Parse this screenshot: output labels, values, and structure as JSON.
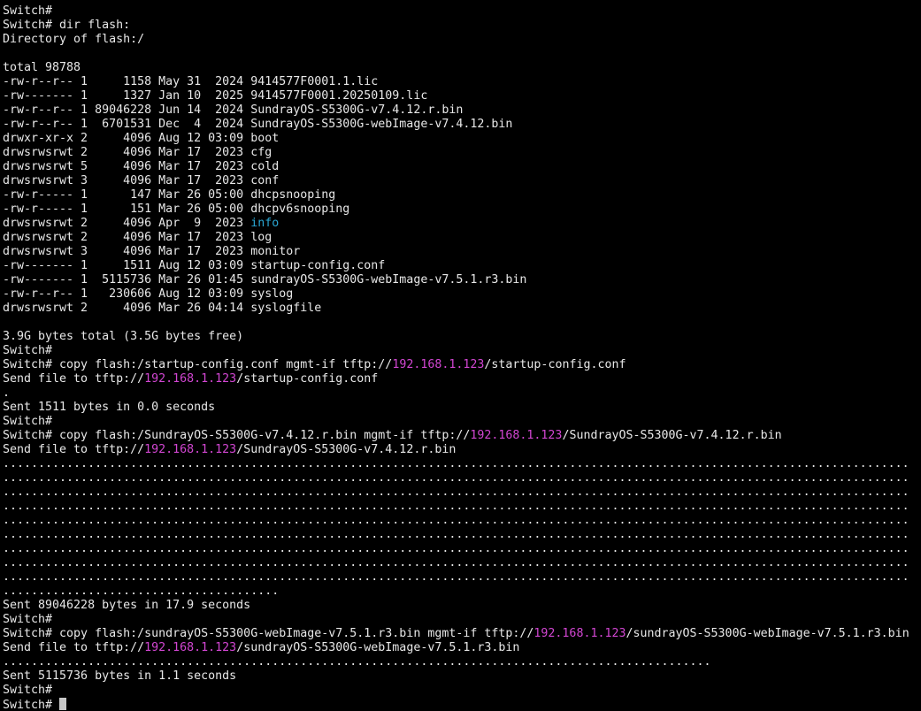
{
  "colors": {
    "background": "#000000",
    "text": "#e8e8e8",
    "ip_address": "#d246d2",
    "directory_info": "#2aa7d4",
    "cursor": "#c8c8c8"
  },
  "terminal": {
    "lines": [
      [
        {
          "t": "Switch#"
        }
      ],
      [
        {
          "t": "Switch#"
        }
      ],
      [
        {
          "t": "Switch# dir flash:"
        }
      ],
      [
        {
          "t": "Directory of flash:/"
        }
      ],
      [
        {
          "t": ""
        }
      ],
      [
        {
          "t": "total 98788"
        }
      ],
      [
        {
          "t": "-rw-r--r-- 1     1158 May 31  2024 9414577F0001.1.lic"
        }
      ],
      [
        {
          "t": "-rw------- 1     1327 Jan 10  2025 9414577F0001.20250109.lic"
        }
      ],
      [
        {
          "t": "-rw-r--r-- 1 89046228 Jun 14  2024 SundrayOS-S5300G-v7.4.12.r.bin"
        }
      ],
      [
        {
          "t": "-rw-r--r-- 1  6701531 Dec  4  2024 SundrayOS-S5300G-webImage-v7.4.12.bin"
        }
      ],
      [
        {
          "t": "drwxr-xr-x 2     4096 Aug 12 03:09 boot"
        }
      ],
      [
        {
          "t": "drwsrwsrwt 2     4096 Mar 17  2023 cfg"
        }
      ],
      [
        {
          "t": "drwsrwsrwt 5     4096 Mar 17  2023 cold"
        }
      ],
      [
        {
          "t": "drwsrwsrwt 3     4096 Mar 17  2023 conf"
        }
      ],
      [
        {
          "t": "-rw-r----- 1      147 Mar 26 05:00 dhcpsnooping"
        }
      ],
      [
        {
          "t": "-rw-r----- 1      151 Mar 26 05:00 dhcpv6snooping"
        }
      ],
      [
        {
          "t": "drwsrwsrwt 2     4096 Apr  9  2023 "
        },
        {
          "t": "info",
          "c": "directory_info"
        }
      ],
      [
        {
          "t": "drwsrwsrwt 2     4096 Mar 17  2023 log"
        }
      ],
      [
        {
          "t": "drwsrwsrwt 3     4096 Mar 17  2023 monitor"
        }
      ],
      [
        {
          "t": "-rw------- 1     1511 Aug 12 03:09 startup-config.conf"
        }
      ],
      [
        {
          "t": "-rw------- 1  5115736 Mar 26 01:45 sundrayOS-S5300G-webImage-v7.5.1.r3.bin"
        }
      ],
      [
        {
          "t": "-rw-r--r-- 1   230606 Aug 12 03:09 syslog"
        }
      ],
      [
        {
          "t": "drwsrwsrwt 2     4096 Mar 26 04:14 syslogfile"
        }
      ],
      [
        {
          "t": ""
        }
      ],
      [
        {
          "t": "3.9G bytes total (3.5G bytes free)"
        }
      ],
      [
        {
          "t": "Switch#"
        }
      ],
      [
        {
          "t": "Switch# copy flash:/startup-config.conf mgmt-if tftp://"
        },
        {
          "t": "192.168.1.123",
          "c": "ip_address"
        },
        {
          "t": "/startup-config.conf"
        }
      ],
      [
        {
          "t": "Send file to tftp://"
        },
        {
          "t": "192.168.1.123",
          "c": "ip_address"
        },
        {
          "t": "/startup-config.conf"
        }
      ],
      [
        {
          "t": "."
        }
      ],
      [
        {
          "t": "Sent 1511 bytes in 0.0 seconds"
        }
      ],
      [
        {
          "t": "Switch#"
        }
      ],
      [
        {
          "t": "Switch# copy flash:/SundrayOS-S5300G-v7.4.12.r.bin mgmt-if tftp://"
        },
        {
          "t": "192.168.1.123",
          "c": "ip_address"
        },
        {
          "t": "/SundrayOS-S5300G-v7.4.12.r.bin"
        }
      ],
      [
        {
          "t": "Send file to tftp://"
        },
        {
          "t": "192.168.1.123",
          "c": "ip_address"
        },
        {
          "t": "/SundrayOS-S5300G-v7.4.12.r.bin"
        }
      ],
      [
        {
          "t": "................................................................................................................................"
        }
      ],
      [
        {
          "t": "................................................................................................................................"
        }
      ],
      [
        {
          "t": "................................................................................................................................"
        }
      ],
      [
        {
          "t": "................................................................................................................................"
        }
      ],
      [
        {
          "t": "................................................................................................................................"
        }
      ],
      [
        {
          "t": "................................................................................................................................"
        }
      ],
      [
        {
          "t": "................................................................................................................................"
        }
      ],
      [
        {
          "t": "................................................................................................................................"
        }
      ],
      [
        {
          "t": "................................................................................................................................"
        }
      ],
      [
        {
          "t": "......................................."
        }
      ],
      [
        {
          "t": "Sent 89046228 bytes in 17.9 seconds"
        }
      ],
      [
        {
          "t": "Switch#"
        }
      ],
      [
        {
          "t": "Switch# copy flash:/sundrayOS-S5300G-webImage-v7.5.1.r3.bin mgmt-if tftp://"
        },
        {
          "t": "192.168.1.123",
          "c": "ip_address"
        },
        {
          "t": "/sundrayOS-S5300G-webImage-v7.5.1.r3.bin"
        }
      ],
      [
        {
          "t": "Send file to tftp://"
        },
        {
          "t": "192.168.1.123",
          "c": "ip_address"
        },
        {
          "t": "/sundrayOS-S5300G-webImage-v7.5.1.r3.bin"
        }
      ],
      [
        {
          "t": "...................................................................................................."
        }
      ],
      [
        {
          "t": "Sent 5115736 bytes in 1.1 seconds"
        }
      ],
      [
        {
          "t": "Switch#"
        }
      ],
      [
        {
          "t": "Switch# "
        },
        {
          "cursor": true
        }
      ]
    ]
  }
}
